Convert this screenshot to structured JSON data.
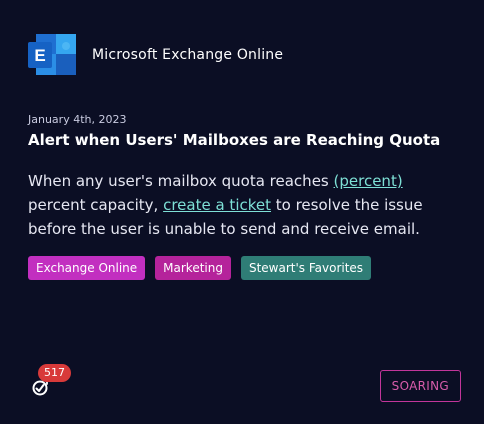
{
  "header": {
    "app_name": "Microsoft Exchange Online",
    "logo_icon": "exchange-logo"
  },
  "post": {
    "date": "January 4th, 2023",
    "title": "Alert when Users' Mailboxes are Reaching Quota",
    "description": {
      "part1": "When any user's mailbox quota reaches ",
      "link1": "(percent)",
      "part2": " percent capacity, ",
      "link2": "create a ticket",
      "part3": " to resolve the issue before the user is unable to send and receive email."
    },
    "tags": [
      {
        "label": "Exchange Online",
        "color": "#c22fc0"
      },
      {
        "label": "Marketing",
        "color": "#b5239b"
      },
      {
        "label": "Stewart's Favorites",
        "color": "#2f7d76"
      }
    ]
  },
  "footer": {
    "vote_icon": "upvote-icon",
    "vote_count": "517",
    "status_label": "SOARING"
  },
  "colors": {
    "background": "#0b0e24",
    "link": "#7ee0d6",
    "badge": "#d83a3a",
    "status_border": "#c2359a"
  }
}
